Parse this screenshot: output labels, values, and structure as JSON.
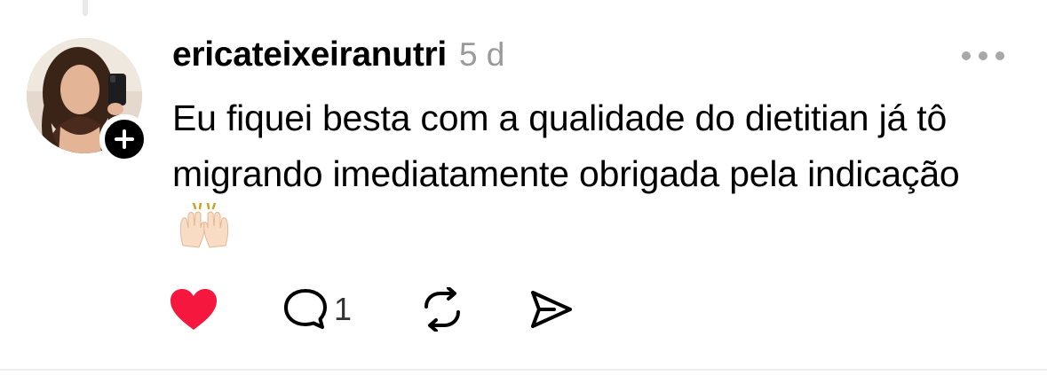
{
  "post": {
    "username": "ericateixeiranutri",
    "timestamp": "5 d",
    "text": "Eu fiquei besta com a qualidade do dietitian já tô migrando imediatamente obrigada pela indicação",
    "emoji": "🙌",
    "avatar_icon": "profile-photo",
    "follow_icon": "plus-icon",
    "more_icon": "ellipsis-icon"
  },
  "actions": {
    "like": {
      "icon": "heart-icon",
      "liked": true,
      "color": "#f5173e"
    },
    "reply": {
      "icon": "comment-bubble-icon",
      "count": "1"
    },
    "repost": {
      "icon": "repost-icon"
    },
    "share": {
      "icon": "send-icon"
    }
  },
  "colors": {
    "text": "#000000",
    "muted": "#9a9a9a",
    "heart": "#f5173e",
    "divider": "#ececec"
  }
}
